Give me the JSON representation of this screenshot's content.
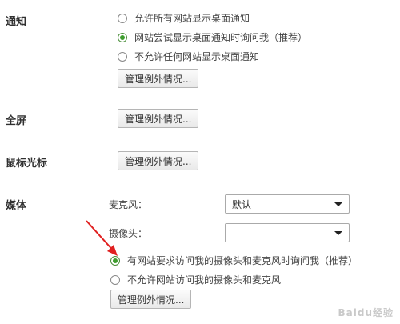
{
  "sections": {
    "notifications": {
      "label": "通知",
      "options": [
        {
          "label": "允许所有网站显示桌面通知",
          "checked": false
        },
        {
          "label": "网站尝试显示桌面通知时询问我（推荐）",
          "checked": true
        },
        {
          "label": "不允许任何网站显示桌面通知",
          "checked": false
        }
      ],
      "button": "管理例外情况..."
    },
    "fullscreen": {
      "label": "全屏",
      "button": "管理例外情况..."
    },
    "mouse_cursor": {
      "label": "鼠标光标",
      "button": "管理例外情况..."
    },
    "media": {
      "label": "媒体",
      "microphone_label": "麦克风：",
      "microphone_value": "默认",
      "camera_label": "摄像头：",
      "camera_value": "",
      "options": [
        {
          "label": "有网站要求访问我的摄像头和麦克风时询问我（推荐）",
          "checked": true
        },
        {
          "label": "不允许网站访问我的摄像头和麦克风",
          "checked": false
        }
      ],
      "button": "管理例外情况..."
    }
  },
  "annotation": {
    "arrow_color": "#e02020"
  },
  "watermark": "Baidu经验"
}
